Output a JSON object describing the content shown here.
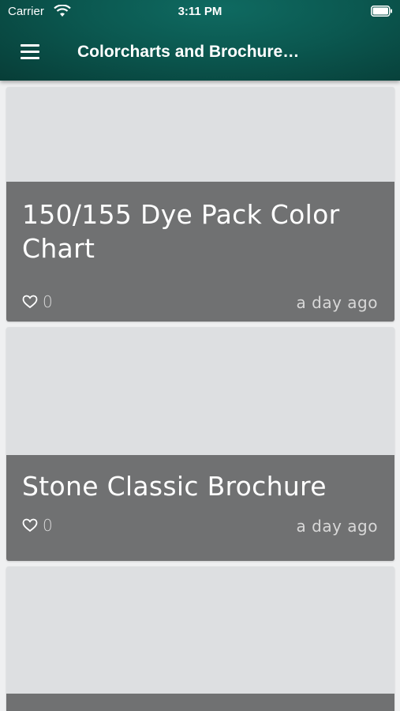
{
  "status_bar": {
    "carrier": "Carrier",
    "time": "3:11 PM",
    "wifi_icon": "wifi-icon",
    "battery_icon": "battery-icon"
  },
  "header": {
    "menu_icon": "hamburger-menu-icon",
    "title": "Colorcharts and Brochure…",
    "background_color": "#0b5850"
  },
  "cards": [
    {
      "title": "150/155 Dye Pack Color Chart",
      "likes": "0",
      "like_icon": "heart-icon",
      "timestamp": "a day ago"
    },
    {
      "title": "Stone Classic Brochure",
      "likes": "0",
      "like_icon": "heart-icon",
      "timestamp": "a day ago"
    },
    {
      "title": "",
      "likes": "",
      "timestamp": ""
    }
  ],
  "colors": {
    "card_image_placeholder": "#dddfe1",
    "card_overlay": "#707172",
    "page_background": "#eff0f1"
  }
}
